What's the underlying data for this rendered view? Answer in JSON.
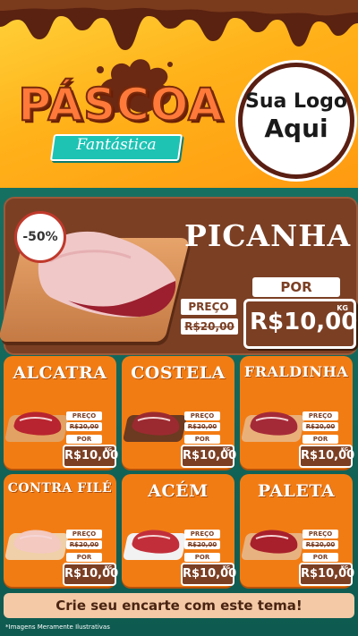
{
  "header": {
    "title": "PÁSCOA",
    "subtitle": "Fantástica",
    "logo_line1": "Sua Logo",
    "logo_line2": "Aqui"
  },
  "hero": {
    "badge": "-50%",
    "name": "PICANHA",
    "preco_label": "PREÇO",
    "old_price": "R$20,00",
    "por_label": "POR",
    "price": "R$10,00",
    "unit": "KG"
  },
  "products": [
    {
      "name": "ALCATRA",
      "preco_label": "PREÇO",
      "old_price": "R$20,00",
      "por_label": "POR",
      "price": "R$10,00",
      "unit": "KG"
    },
    {
      "name": "COSTELA",
      "preco_label": "PREÇO",
      "old_price": "R$20,00",
      "por_label": "POR",
      "price": "R$10,00",
      "unit": "KG"
    },
    {
      "name": "FRALDINHA",
      "preco_label": "PREÇO",
      "old_price": "R$20,00",
      "por_label": "POR",
      "price": "R$10,00",
      "unit": "KG"
    },
    {
      "name": "CONTRA FILÉ",
      "preco_label": "PREÇO",
      "old_price": "R$20,00",
      "por_label": "POR",
      "price": "R$10,00",
      "unit": "KG"
    },
    {
      "name": "ACÉM",
      "preco_label": "PREÇO",
      "old_price": "R$20,00",
      "por_label": "POR",
      "price": "R$10,00",
      "unit": "KG"
    },
    {
      "name": "PALETA",
      "preco_label": "PREÇO",
      "old_price": "R$20,00",
      "por_label": "POR",
      "price": "R$10,00",
      "unit": "KG"
    }
  ],
  "cta": "Crie seu encarte com este tema!",
  "disclaimer": "*Imagens Meramente Ilustrativas",
  "colors": {
    "brown": "#7b3f24",
    "orange": "#f27c14",
    "teal": "#1a7a6a",
    "yellow": "#ffc12a"
  }
}
